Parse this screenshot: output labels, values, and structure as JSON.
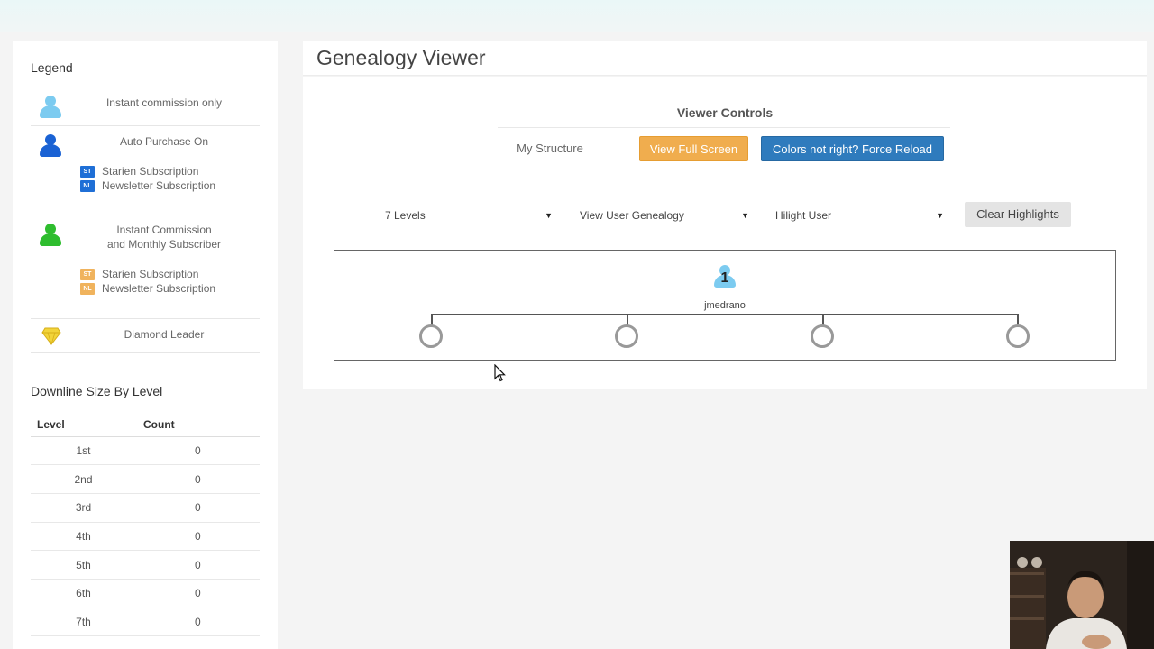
{
  "sidebar": {
    "legend_title": "Legend",
    "legend": [
      {
        "label": "Instant commission only",
        "icon": "person-light-blue-icon",
        "color": "#7ccbf0"
      },
      {
        "label": "Auto Purchase On",
        "icon": "person-blue-icon",
        "color": "#1a62d4",
        "subs": [
          {
            "badge": "ST",
            "label": "Starien Subscription"
          },
          {
            "badge": "NL",
            "label": "Newsletter Subscription"
          }
        ]
      },
      {
        "label_line1": "Instant Commission",
        "label_line2": "and Monthly Subscriber",
        "icon": "person-green-icon",
        "color": "#2ebd2e",
        "subs": [
          {
            "badge": "ST",
            "label": "Starien Subscription"
          },
          {
            "badge": "NL",
            "label": "Newsletter Subscription"
          }
        ]
      },
      {
        "label": "Diamond Leader",
        "icon": "diamond-icon",
        "color": "#e8c52a"
      }
    ],
    "downline_title": "Downline Size By Level",
    "table": {
      "headers": [
        "Level",
        "Count"
      ],
      "rows": [
        {
          "level": "1st",
          "count": "0"
        },
        {
          "level": "2nd",
          "count": "0"
        },
        {
          "level": "3rd",
          "count": "0"
        },
        {
          "level": "4th",
          "count": "0"
        },
        {
          "level": "5th",
          "count": "0"
        },
        {
          "level": "6th",
          "count": "0"
        },
        {
          "level": "7th",
          "count": "0"
        }
      ]
    }
  },
  "main": {
    "title": "Genealogy Viewer",
    "controls_title": "Viewer Controls",
    "buttons": {
      "my_structure": "My Structure",
      "full_screen": "View Full Screen",
      "force_reload": "Colors not right? Force Reload",
      "clear_highlights": "Clear Highlights"
    },
    "selects": {
      "levels": "7 Levels",
      "genealogy": "View User Genealogy",
      "hilight": "Hilight User"
    },
    "tree": {
      "root_user": "jmedrano",
      "root_badge": "1",
      "child_nodes": 4
    }
  },
  "colors": {
    "full_screen_btn": "#f0ad4e",
    "reload_btn": "#2f7bbd"
  }
}
